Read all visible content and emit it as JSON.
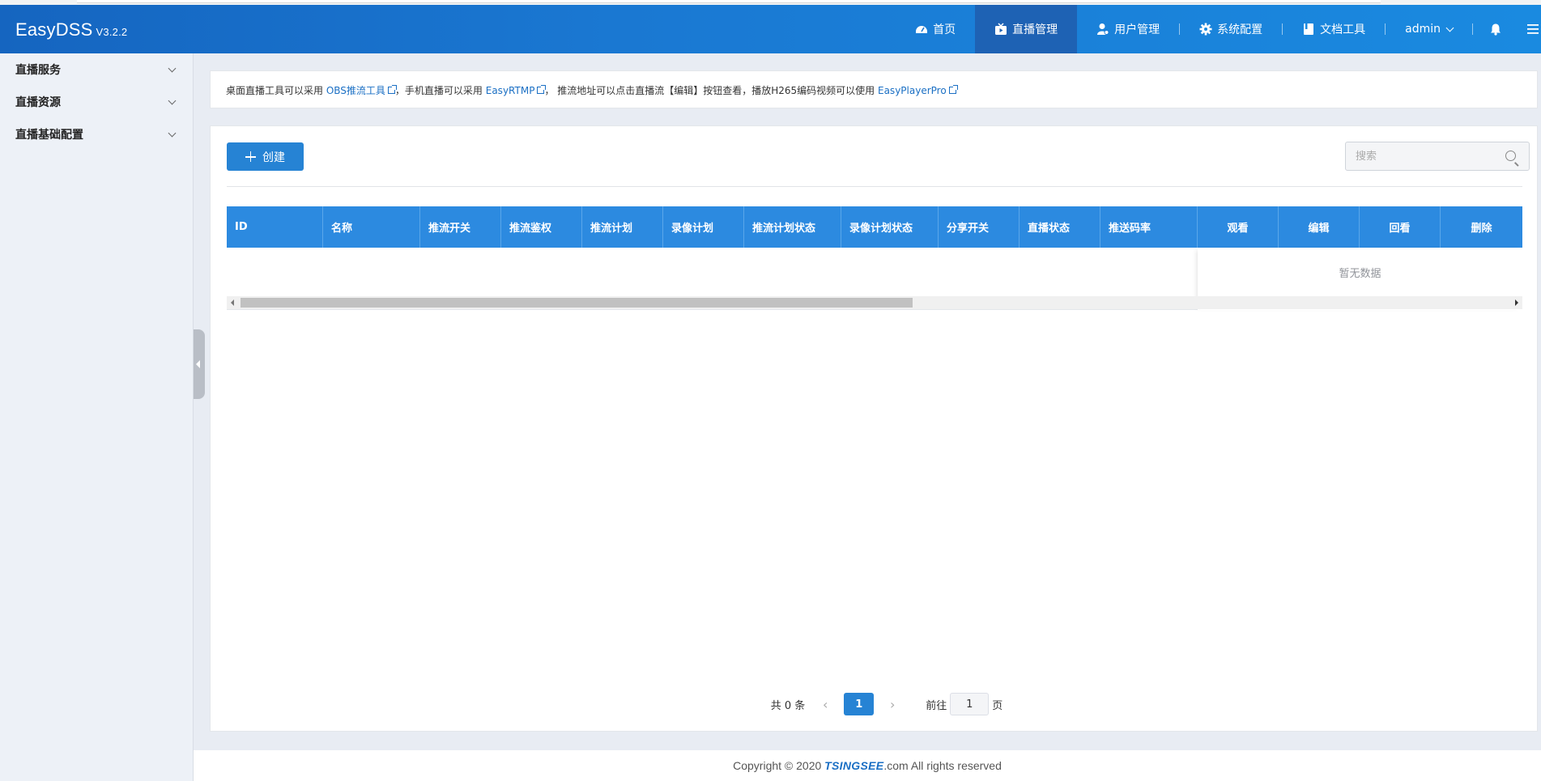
{
  "app": {
    "name": "EasyDSS",
    "version": "V3.2.2"
  },
  "nav": {
    "items": [
      {
        "label": "首页",
        "icon": "dashboard-icon"
      },
      {
        "label": "直播管理",
        "icon": "live-icon",
        "active": true
      },
      {
        "label": "用户管理",
        "icon": "user-icon"
      },
      {
        "label": "系统配置",
        "icon": "gear-icon"
      },
      {
        "label": "文档工具",
        "icon": "book-icon"
      }
    ],
    "user": "admin"
  },
  "sidebar": {
    "items": [
      {
        "label": "直播服务"
      },
      {
        "label": "直播资源"
      },
      {
        "label": "直播基础配置"
      }
    ]
  },
  "notice": {
    "t1": "桌面直播工具可以采用 ",
    "link1": "OBS推流工具",
    "t2": "，手机直播可以采用 ",
    "link2": "EasyRTMP",
    "t3": "，  推流地址可以点击直播流【编辑】按钮查看，播放H265编码视频可以使用 ",
    "link3": "EasyPlayerPro"
  },
  "toolbar": {
    "create_label": "创建",
    "search_placeholder": "搜索"
  },
  "table": {
    "columns": [
      "ID",
      "名称",
      "推流开关",
      "推流鉴权",
      "推流计划",
      "录像计划",
      "推流计划状态",
      "录像计划状态",
      "分享开关",
      "直播状态",
      "推送码率",
      "观看",
      "编辑",
      "回看",
      "删除"
    ],
    "empty_text": "暂无数据"
  },
  "pagination": {
    "total_text": "共 0 条",
    "current_page": "1",
    "goto_label": "前往",
    "page_suffix": "页",
    "goto_value": "1"
  },
  "footer": {
    "prefix": "Copyright © 2020 ",
    "brand": "TSINGSEE",
    "suffix": ".com All rights reserved"
  },
  "colors": {
    "primary": "#2683d4",
    "header": "#1a78d2",
    "table_header": "#2c8ae0"
  }
}
